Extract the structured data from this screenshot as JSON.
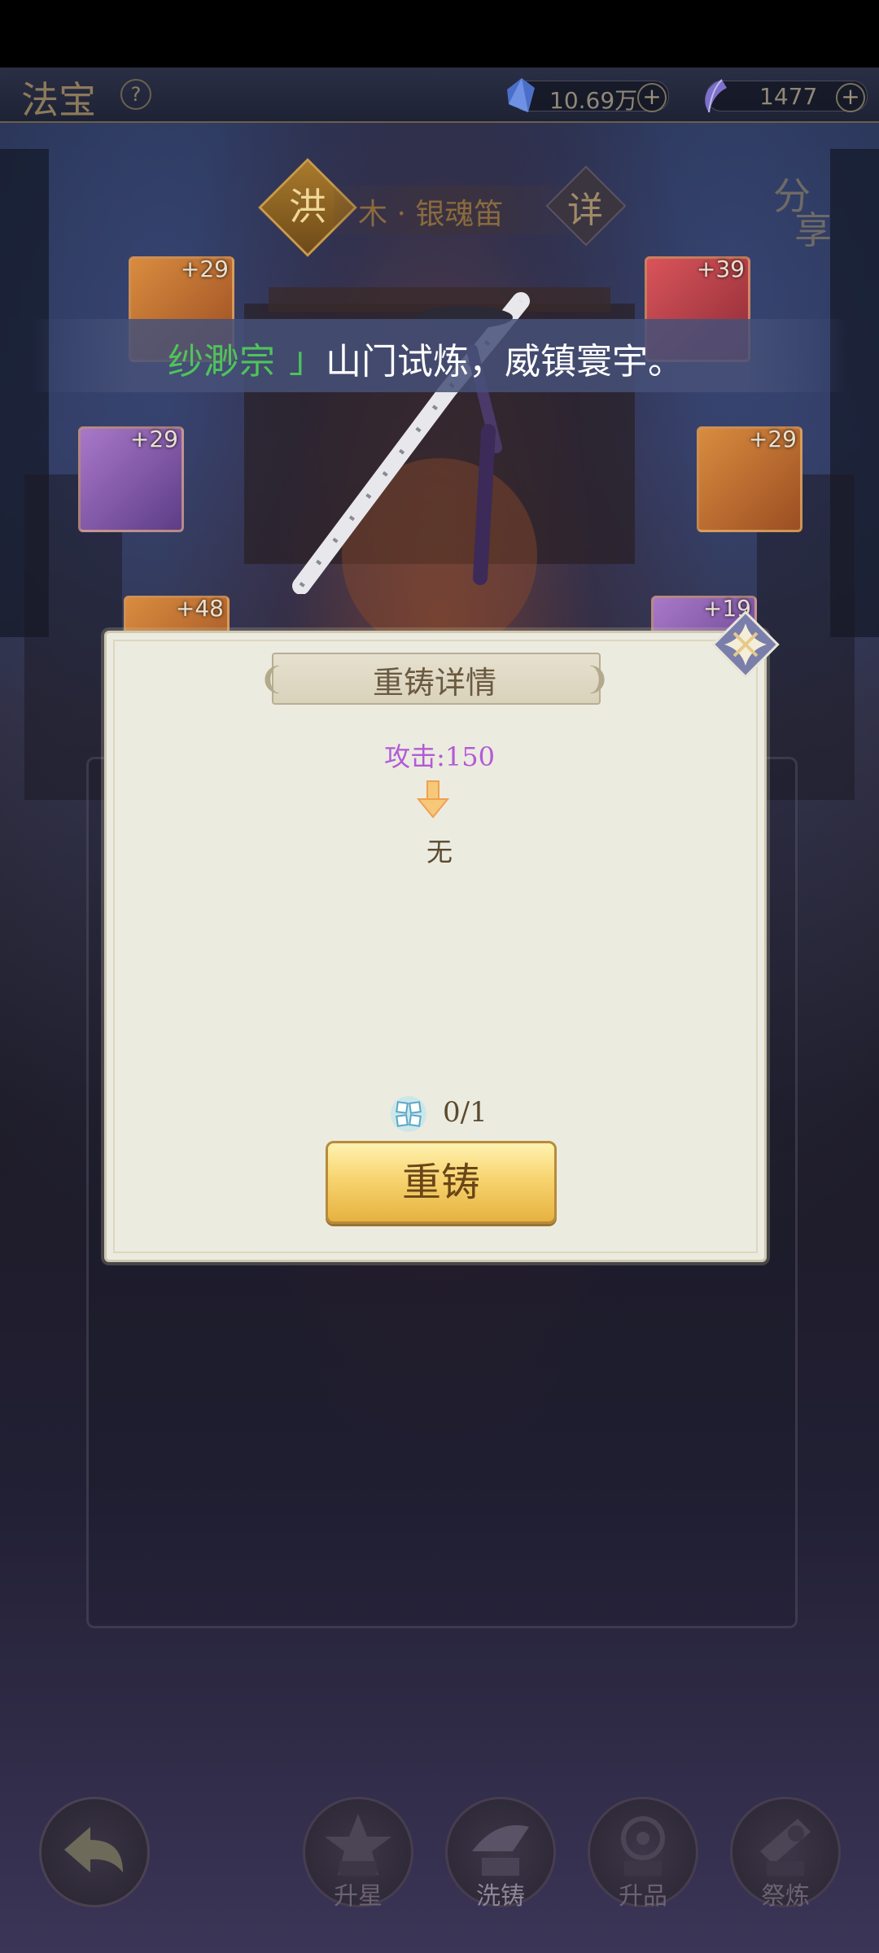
{
  "topbar": {
    "title": "法宝",
    "help": "?",
    "currencies": [
      {
        "icon": "blue-crystal-icon",
        "value": "10.69万",
        "plus": "+"
      },
      {
        "icon": "purple-crystal-icon",
        "value": "1477",
        "plus": "+"
      }
    ]
  },
  "header": {
    "badge": "洪",
    "item_name": "木 · 银魂笛",
    "detail": "详",
    "share_1": "分",
    "share_2": "享"
  },
  "cards": [
    {
      "level": "+29",
      "color": "orange"
    },
    {
      "level": "+39",
      "color": "red"
    },
    {
      "level": "+29",
      "color": "purple"
    },
    {
      "level": "+29",
      "color": "orange"
    },
    {
      "level": "+48",
      "color": "orange"
    },
    {
      "level": "+19",
      "color": "purple"
    }
  ],
  "banner": {
    "sect": "纱渺宗",
    "bracket": "」",
    "motto": "山门试炼，威镇寰宇。"
  },
  "dialog": {
    "title": "重铸详情",
    "attribute": "攻击:150",
    "result": "无",
    "material_count": "0/1",
    "recast_button": "重铸"
  },
  "nav": {
    "items": [
      {
        "label": "升星",
        "icon": "star-up-icon"
      },
      {
        "label": "洗铸",
        "icon": "wash-cast-icon"
      },
      {
        "label": "升品",
        "icon": "grade-up-icon"
      },
      {
        "label": "祭炼",
        "icon": "refine-icon"
      }
    ]
  }
}
